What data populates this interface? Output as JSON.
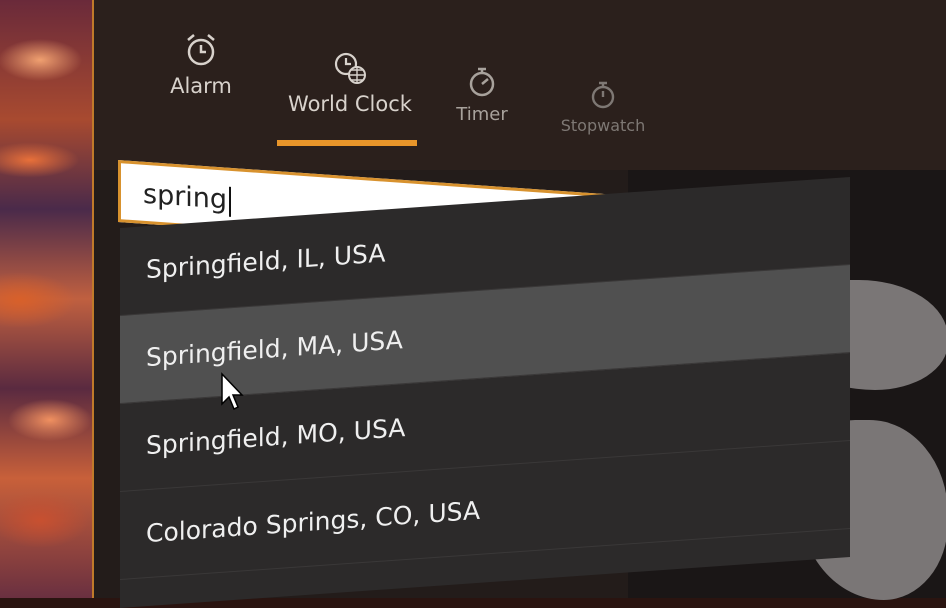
{
  "nav": {
    "items": [
      {
        "label": "Alarm",
        "icon": "alarm-clock-icon"
      },
      {
        "label": "World Clock",
        "icon": "globe-clock-icon"
      },
      {
        "label": "Timer",
        "icon": "stopwatch-timer-icon"
      },
      {
        "label": "Stopwatch",
        "icon": "stopwatch-icon"
      }
    ],
    "active": "World Clock"
  },
  "search": {
    "value": "spring",
    "clear_icon": "close-icon",
    "search_icon": "search-icon"
  },
  "suggestions": [
    {
      "label": "Springfield, IL, USA"
    },
    {
      "label": "Springfield, MA, USA"
    },
    {
      "label": "Springfield, MO, USA"
    },
    {
      "label": "Colorado Springs, CO, USA"
    }
  ],
  "colors": {
    "accent": "#e8952a",
    "highlight_row": "#505050",
    "panel": "#2c2a2a"
  }
}
